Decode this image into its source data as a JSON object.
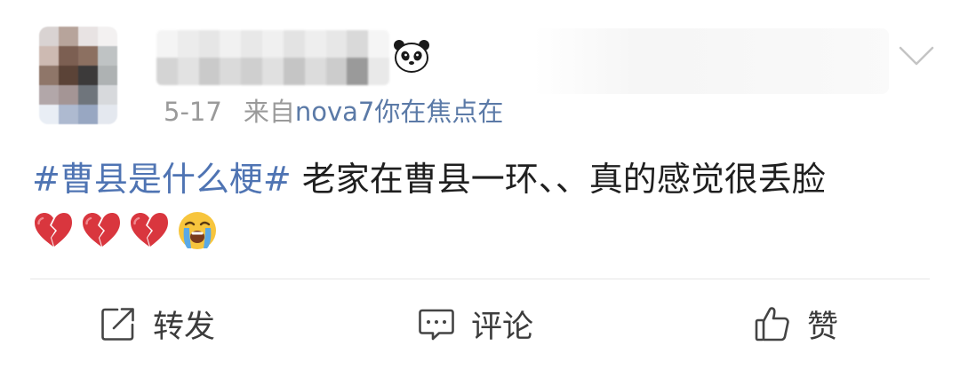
{
  "post": {
    "date": "5-17",
    "source_prefix": "来自",
    "source_device": "nova7你在焦点在",
    "hashtag": "#曹县是什么梗#",
    "body_text": " 老家在曹县一环、、真的感觉很丢脸",
    "emojis": [
      "broken-heart",
      "broken-heart",
      "broken-heart",
      "loudly-crying-face"
    ]
  },
  "actions": {
    "repost_label": "转发",
    "comment_label": "评论",
    "like_label": "赞"
  },
  "colors": {
    "link_blue": "#5b7aa7",
    "hashtag_blue": "#4f74b3",
    "meta_gray": "#9a9a9a",
    "broken_heart_red": "#d9363e",
    "divider": "#e6e6e6"
  },
  "icons": {
    "username_badge": "panda-icon",
    "menu": "chevron-down-icon",
    "repost": "share-icon",
    "comment": "comment-icon",
    "like": "thumbs-up-icon"
  }
}
